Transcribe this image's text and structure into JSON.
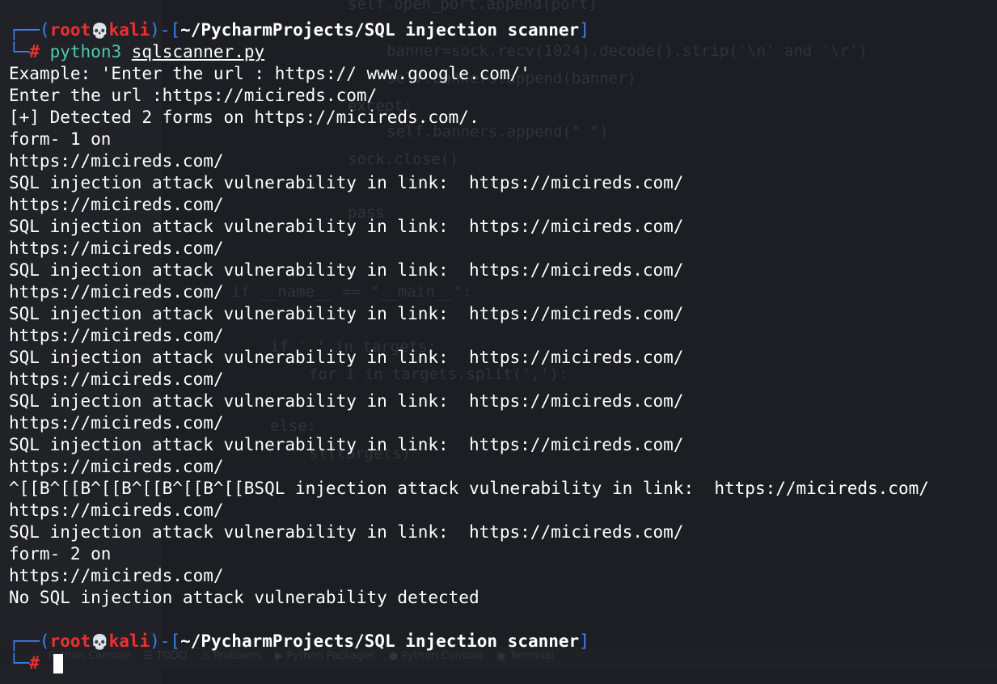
{
  "prompt1": {
    "frame_top_left": "┌──(",
    "user": "root",
    "skull_icon": "💀",
    "host": "kali",
    "frame_mid": ")-[",
    "cwd": "~/PycharmProjects/SQL injection scanner",
    "frame_close": "]",
    "frame_bottom_left": "└─",
    "hash": "#",
    "command": "python3",
    "argument": "sqlscanner.py"
  },
  "output": [
    "Example: 'Enter the url : https:// www.google.com/'",
    "Enter the url :https://micireds.com/",
    "[+] Detected 2 forms on https://micireds.com/.",
    "form- 1 on",
    "https://micireds.com/",
    "SQL injection attack vulnerability in link:  https://micireds.com/",
    "https://micireds.com/",
    "SQL injection attack vulnerability in link:  https://micireds.com/",
    "https://micireds.com/",
    "SQL injection attack vulnerability in link:  https://micireds.com/",
    "https://micireds.com/",
    "SQL injection attack vulnerability in link:  https://micireds.com/",
    "https://micireds.com/",
    "SQL injection attack vulnerability in link:  https://micireds.com/",
    "https://micireds.com/",
    "SQL injection attack vulnerability in link:  https://micireds.com/",
    "https://micireds.com/",
    "SQL injection attack vulnerability in link:  https://micireds.com/",
    "https://micireds.com/",
    "^[[B^[[B^[[B^[[B^[[B^[[BSQL injection attack vulnerability in link:  https://micireds.com/",
    "https://micireds.com/",
    "SQL injection attack vulnerability in link:  https://micireds.com/",
    "form- 2 on",
    "https://micireds.com/",
    "No SQL injection attack vulnerability detected",
    ""
  ],
  "prompt2": {
    "frame_top_left": "┌──(",
    "user": "root",
    "skull_icon": "💀",
    "host": "kali",
    "frame_mid": ")-[",
    "cwd": "~/PycharmProjects/SQL injection scanner",
    "frame_close": "]",
    "frame_bottom_left": "└─",
    "hash": "#"
  },
  "colors": {
    "background": "#1c1e23",
    "frame_blue": "#3b82f6",
    "user_red": "#ef2f2f",
    "command_teal": "#4ec9b0",
    "text_white": "#ffffff"
  }
}
